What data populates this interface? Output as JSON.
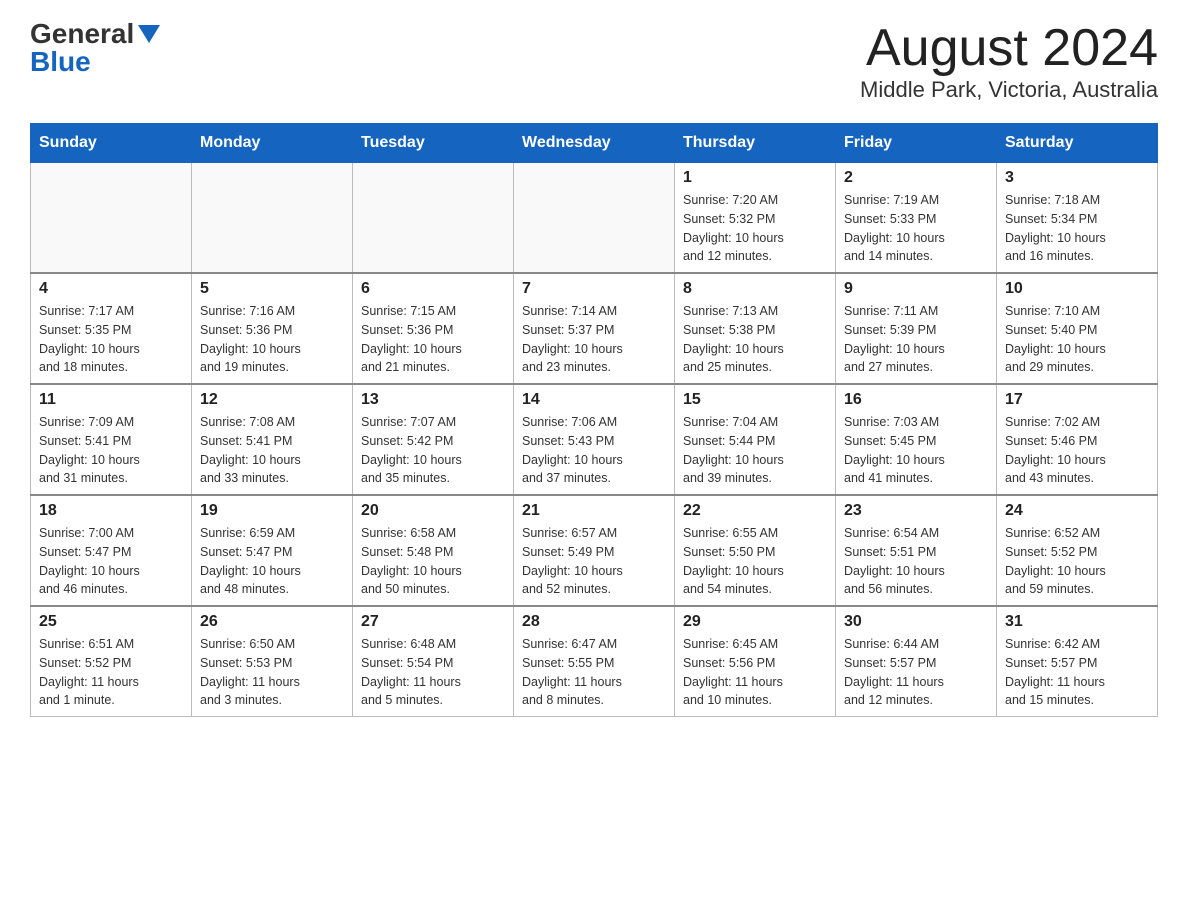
{
  "header": {
    "logo_line1": "General",
    "logo_line2": "Blue",
    "month_title": "August 2024",
    "location": "Middle Park, Victoria, Australia"
  },
  "days_of_week": [
    "Sunday",
    "Monday",
    "Tuesday",
    "Wednesday",
    "Thursday",
    "Friday",
    "Saturday"
  ],
  "weeks": [
    [
      {
        "day": "",
        "info": ""
      },
      {
        "day": "",
        "info": ""
      },
      {
        "day": "",
        "info": ""
      },
      {
        "day": "",
        "info": ""
      },
      {
        "day": "1",
        "info": "Sunrise: 7:20 AM\nSunset: 5:32 PM\nDaylight: 10 hours\nand 12 minutes."
      },
      {
        "day": "2",
        "info": "Sunrise: 7:19 AM\nSunset: 5:33 PM\nDaylight: 10 hours\nand 14 minutes."
      },
      {
        "day": "3",
        "info": "Sunrise: 7:18 AM\nSunset: 5:34 PM\nDaylight: 10 hours\nand 16 minutes."
      }
    ],
    [
      {
        "day": "4",
        "info": "Sunrise: 7:17 AM\nSunset: 5:35 PM\nDaylight: 10 hours\nand 18 minutes."
      },
      {
        "day": "5",
        "info": "Sunrise: 7:16 AM\nSunset: 5:36 PM\nDaylight: 10 hours\nand 19 minutes."
      },
      {
        "day": "6",
        "info": "Sunrise: 7:15 AM\nSunset: 5:36 PM\nDaylight: 10 hours\nand 21 minutes."
      },
      {
        "day": "7",
        "info": "Sunrise: 7:14 AM\nSunset: 5:37 PM\nDaylight: 10 hours\nand 23 minutes."
      },
      {
        "day": "8",
        "info": "Sunrise: 7:13 AM\nSunset: 5:38 PM\nDaylight: 10 hours\nand 25 minutes."
      },
      {
        "day": "9",
        "info": "Sunrise: 7:11 AM\nSunset: 5:39 PM\nDaylight: 10 hours\nand 27 minutes."
      },
      {
        "day": "10",
        "info": "Sunrise: 7:10 AM\nSunset: 5:40 PM\nDaylight: 10 hours\nand 29 minutes."
      }
    ],
    [
      {
        "day": "11",
        "info": "Sunrise: 7:09 AM\nSunset: 5:41 PM\nDaylight: 10 hours\nand 31 minutes."
      },
      {
        "day": "12",
        "info": "Sunrise: 7:08 AM\nSunset: 5:41 PM\nDaylight: 10 hours\nand 33 minutes."
      },
      {
        "day": "13",
        "info": "Sunrise: 7:07 AM\nSunset: 5:42 PM\nDaylight: 10 hours\nand 35 minutes."
      },
      {
        "day": "14",
        "info": "Sunrise: 7:06 AM\nSunset: 5:43 PM\nDaylight: 10 hours\nand 37 minutes."
      },
      {
        "day": "15",
        "info": "Sunrise: 7:04 AM\nSunset: 5:44 PM\nDaylight: 10 hours\nand 39 minutes."
      },
      {
        "day": "16",
        "info": "Sunrise: 7:03 AM\nSunset: 5:45 PM\nDaylight: 10 hours\nand 41 minutes."
      },
      {
        "day": "17",
        "info": "Sunrise: 7:02 AM\nSunset: 5:46 PM\nDaylight: 10 hours\nand 43 minutes."
      }
    ],
    [
      {
        "day": "18",
        "info": "Sunrise: 7:00 AM\nSunset: 5:47 PM\nDaylight: 10 hours\nand 46 minutes."
      },
      {
        "day": "19",
        "info": "Sunrise: 6:59 AM\nSunset: 5:47 PM\nDaylight: 10 hours\nand 48 minutes."
      },
      {
        "day": "20",
        "info": "Sunrise: 6:58 AM\nSunset: 5:48 PM\nDaylight: 10 hours\nand 50 minutes."
      },
      {
        "day": "21",
        "info": "Sunrise: 6:57 AM\nSunset: 5:49 PM\nDaylight: 10 hours\nand 52 minutes."
      },
      {
        "day": "22",
        "info": "Sunrise: 6:55 AM\nSunset: 5:50 PM\nDaylight: 10 hours\nand 54 minutes."
      },
      {
        "day": "23",
        "info": "Sunrise: 6:54 AM\nSunset: 5:51 PM\nDaylight: 10 hours\nand 56 minutes."
      },
      {
        "day": "24",
        "info": "Sunrise: 6:52 AM\nSunset: 5:52 PM\nDaylight: 10 hours\nand 59 minutes."
      }
    ],
    [
      {
        "day": "25",
        "info": "Sunrise: 6:51 AM\nSunset: 5:52 PM\nDaylight: 11 hours\nand 1 minute."
      },
      {
        "day": "26",
        "info": "Sunrise: 6:50 AM\nSunset: 5:53 PM\nDaylight: 11 hours\nand 3 minutes."
      },
      {
        "day": "27",
        "info": "Sunrise: 6:48 AM\nSunset: 5:54 PM\nDaylight: 11 hours\nand 5 minutes."
      },
      {
        "day": "28",
        "info": "Sunrise: 6:47 AM\nSunset: 5:55 PM\nDaylight: 11 hours\nand 8 minutes."
      },
      {
        "day": "29",
        "info": "Sunrise: 6:45 AM\nSunset: 5:56 PM\nDaylight: 11 hours\nand 10 minutes."
      },
      {
        "day": "30",
        "info": "Sunrise: 6:44 AM\nSunset: 5:57 PM\nDaylight: 11 hours\nand 12 minutes."
      },
      {
        "day": "31",
        "info": "Sunrise: 6:42 AM\nSunset: 5:57 PM\nDaylight: 11 hours\nand 15 minutes."
      }
    ]
  ]
}
